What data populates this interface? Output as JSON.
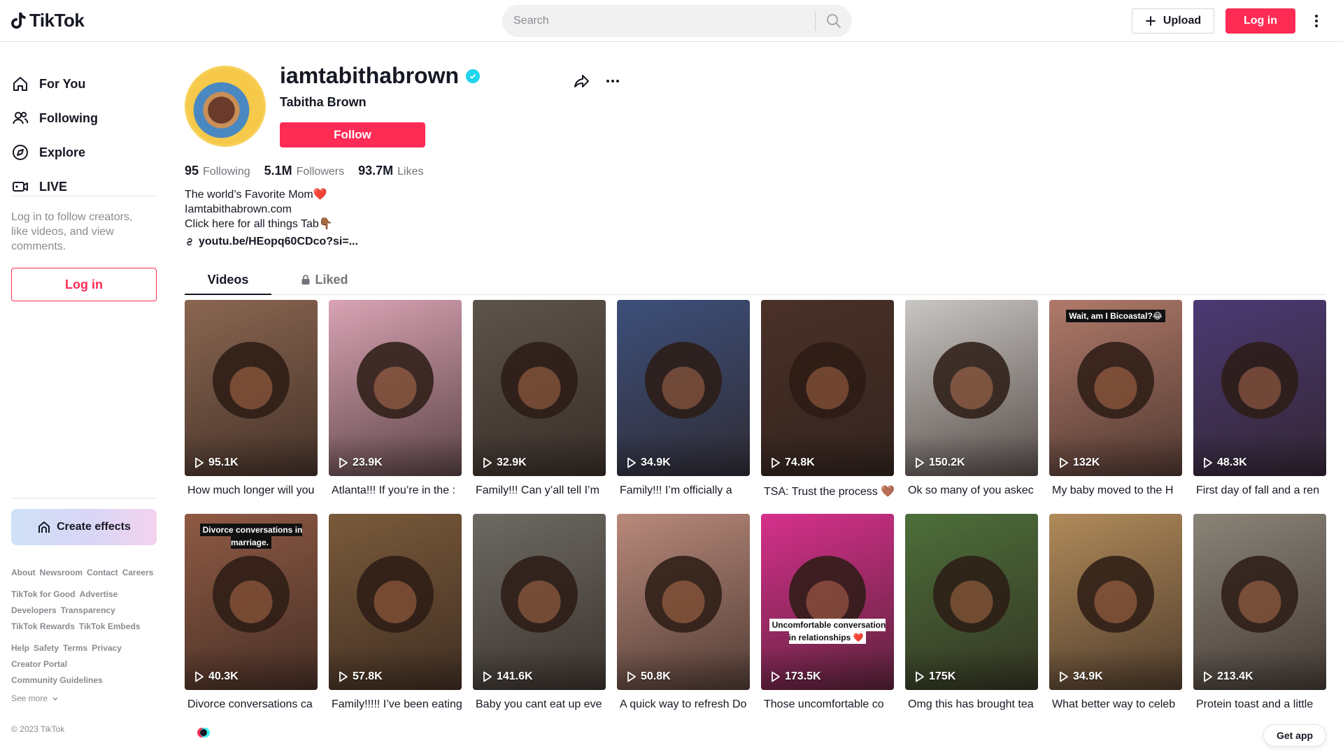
{
  "header": {
    "brand": "TikTok",
    "search_placeholder": "Search",
    "upload_label": "Upload",
    "login_label": "Log in"
  },
  "sidebar": {
    "nav": [
      {
        "label": "For You",
        "icon": "home-icon"
      },
      {
        "label": "Following",
        "icon": "following-icon"
      },
      {
        "label": "Explore",
        "icon": "compass-icon"
      },
      {
        "label": "LIVE",
        "icon": "live-icon"
      }
    ],
    "hint": "Log in to follow creators, like videos, and view comments.",
    "login_label": "Log in",
    "create_effects_label": "Create effects",
    "footer": {
      "row1": [
        "About",
        "Newsroom",
        "Contact",
        "Careers"
      ],
      "row2": [
        "TikTok for Good",
        "Advertise"
      ],
      "row3": [
        "Developers",
        "Transparency"
      ],
      "row4": [
        "TikTok Rewards",
        "TikTok Embeds"
      ],
      "row5": [
        "Help",
        "Safety",
        "Terms",
        "Privacy"
      ],
      "row6": [
        "Creator Portal"
      ],
      "row7": [
        "Community Guidelines"
      ],
      "see_more": "See more",
      "copyright": "© 2023 TikTok"
    }
  },
  "profile": {
    "username": "iamtabithabrown",
    "display_name": "Tabitha Brown",
    "follow_label": "Follow",
    "stats": [
      {
        "value": "95",
        "label": "Following"
      },
      {
        "value": "5.1M",
        "label": "Followers"
      },
      {
        "value": "93.7M",
        "label": "Likes"
      }
    ],
    "bio_lines": [
      "The world’s Favorite Mom❤️",
      "Iamtabithabrown.com",
      "Click here for all things Tab👇🏾"
    ],
    "link": "youtu.be/HEopq60CDco?si=..."
  },
  "tabs": {
    "videos": "Videos",
    "liked": "Liked"
  },
  "colors": {
    "accent": "#fe2c55",
    "verified": "#20d5ec"
  },
  "videos": [
    {
      "views": "95.1K",
      "desc": "How much longer will you",
      "bg": "#8a6650"
    },
    {
      "views": "23.9K",
      "desc": "Atlanta!!! If you’re in the :",
      "bg": "#d9a3b4",
      "tag": ""
    },
    {
      "views": "32.9K",
      "desc": "Family!!! Can y’all tell I’m",
      "bg": "#5d544b"
    },
    {
      "views": "34.9K",
      "desc": "Family!!! I’m officially a",
      "bg": "#3d4f7a"
    },
    {
      "views": "74.8K",
      "desc": "TSA: Trust the process 🤎",
      "bg": "#4a3128"
    },
    {
      "views": "150.2K",
      "desc": "Ok so many of you askec",
      "bg": "#c9c6c3"
    },
    {
      "views": "132K",
      "desc": "My baby moved to the H",
      "bg": "#b07a6a",
      "tag": "Wait, am I Bicoastal?😂"
    },
    {
      "views": "48.3K",
      "desc": "First day of fall and a ren",
      "bg": "#4b3a74"
    },
    {
      "views": "40.3K",
      "desc": "Divorce conversations ca",
      "bg": "#8f5a44",
      "tag": "Divorce conversations in marriage."
    },
    {
      "views": "57.8K",
      "desc": "Family!!!!! I’ve been eating",
      "bg": "#7a5a3a"
    },
    {
      "views": "141.6K",
      "desc": "Baby you cant eat up eve",
      "bg": "#6c6a62"
    },
    {
      "views": "50.8K",
      "desc": "A quick way to refresh Do",
      "bg": "#b8897a"
    },
    {
      "views": "173.5K",
      "desc": "Those uncomfortable co",
      "bg": "#d6308c",
      "tag": "Uncomfortable conversation in relationships ❤️",
      "tag_light": true
    },
    {
      "views": "175K",
      "desc": "Omg this has brought tea",
      "bg": "#4d6f3a"
    },
    {
      "views": "34.9K",
      "desc": "What better way to celeb",
      "bg": "#b08a5a"
    },
    {
      "views": "213.4K",
      "desc": "Protein toast and a little",
      "bg": "#8a8478"
    }
  ],
  "get_app_label": "Get app"
}
